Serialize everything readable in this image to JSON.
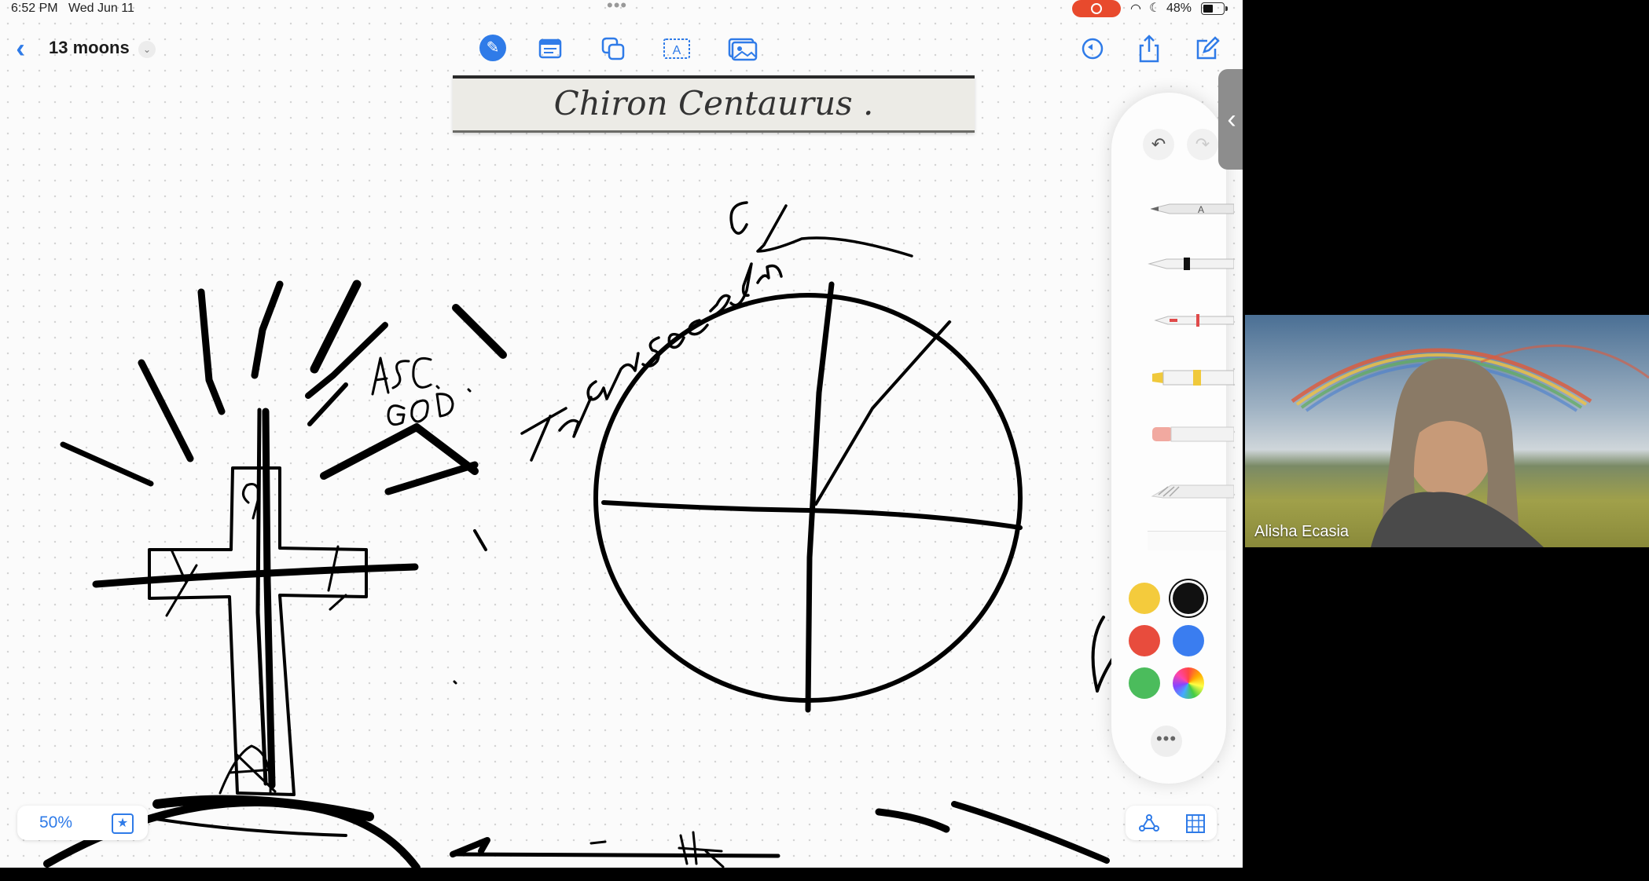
{
  "status_bar": {
    "time": "6:52 PM",
    "date": "Wed Jun 11",
    "battery_percent": "48%",
    "recording": true
  },
  "toolbar": {
    "document_title": "13 moons",
    "left_icons": [
      "chevron-left-icon",
      "chevron-down-icon"
    ],
    "center_icons": [
      "pen-icon",
      "text-box-icon",
      "shapes-icon",
      "text-icon",
      "photo-icon"
    ],
    "right_icons": [
      "undo-history-icon",
      "share-icon",
      "compose-icon"
    ]
  },
  "canvas": {
    "image_caption": "Chiron Centaurus .",
    "handwriting": [
      "ASC.",
      "GOD.",
      "transcendence"
    ],
    "zoom": "50%"
  },
  "tool_palette": {
    "tools": [
      "monoline-pen",
      "fountain-pen",
      "pen-red",
      "highlighter-yellow",
      "eraser",
      "pattern-tool"
    ],
    "colors": [
      "#f4cb3c",
      "#111111",
      "#e84c3d",
      "#3a7df0",
      "#4bbc5c",
      "rainbow"
    ],
    "selected_color": "#111111"
  },
  "video_call": {
    "participant_name": "Alisha Ecasia"
  }
}
